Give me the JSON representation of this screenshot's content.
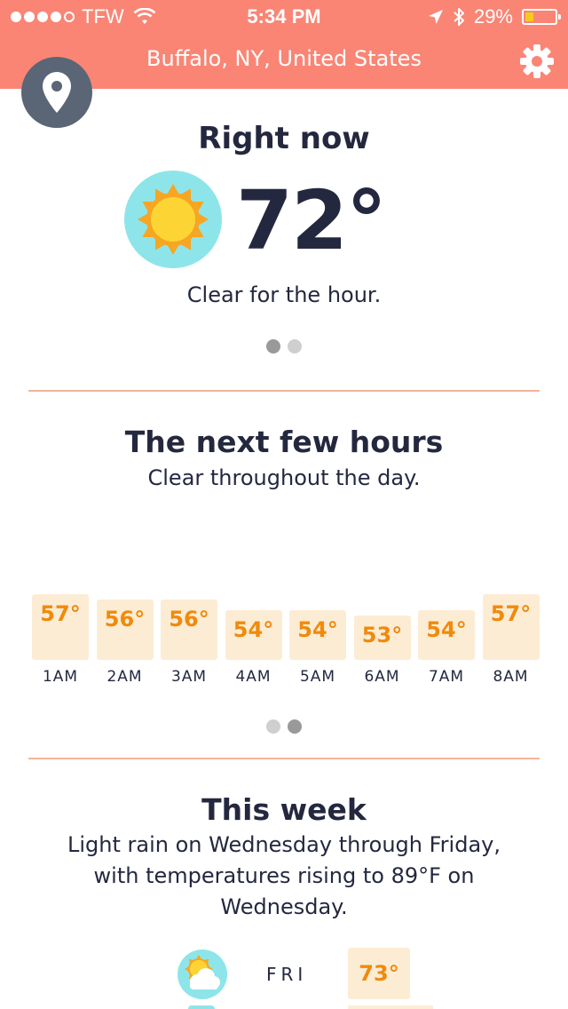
{
  "status_bar": {
    "carrier": "TFW",
    "time": "5:34 PM",
    "battery": "29%",
    "battery_level": 0.29,
    "signal_bars_filled": 4,
    "signal_bars_total": 5
  },
  "header": {
    "location": "Buffalo, NY, United States",
    "bg_color": "#fa8575",
    "settings_icon": "gear-icon",
    "location_icon": "map-pin-icon"
  },
  "right_now": {
    "title": "Right now",
    "temperature": "72°",
    "summary": "Clear for the hour.",
    "icon": "sun-icon",
    "page_index": 0,
    "page_count": 2
  },
  "next_hours": {
    "title": "The next few hours",
    "summary": "Clear throughout the day.",
    "page_index": 1,
    "page_count": 2,
    "hours": [
      {
        "label": "1AM",
        "temp": "57°"
      },
      {
        "label": "2AM",
        "temp": "56°"
      },
      {
        "label": "3AM",
        "temp": "56°"
      },
      {
        "label": "4AM",
        "temp": "54°"
      },
      {
        "label": "5AM",
        "temp": "54°"
      },
      {
        "label": "6AM",
        "temp": "53°"
      },
      {
        "label": "7AM",
        "temp": "54°"
      },
      {
        "label": "8AM",
        "temp": "57°"
      }
    ]
  },
  "this_week": {
    "title": "This week",
    "summary_line1": "Light rain on Wednesday through Friday,",
    "summary_line2": "with temperatures rising to 89°F on",
    "summary_line3": "Wednesday.",
    "days": [
      {
        "day": "FRI",
        "temp": "73°",
        "icon": "partly-cloudy-icon"
      }
    ]
  },
  "colors": {
    "accent": "#fa8575",
    "temp_text": "#f08a0c",
    "temp_bg": "#fdecd4",
    "divider": "#f4b499",
    "sun_bg": "#8ee5e9"
  }
}
